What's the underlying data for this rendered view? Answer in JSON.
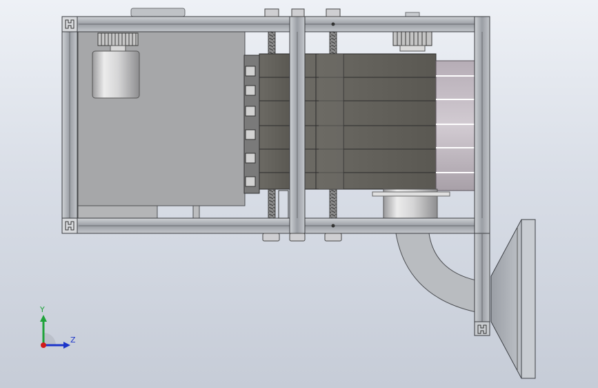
{
  "viewport": {
    "model_name": "",
    "background_top": "#eef1f6",
    "background_bottom": "#c6ccd7"
  },
  "triad": {
    "y_label": "Y",
    "z_label": "Z",
    "y_color": "#1fa33a",
    "z_color": "#1c35c9",
    "x_color": "#d11a1a"
  }
}
